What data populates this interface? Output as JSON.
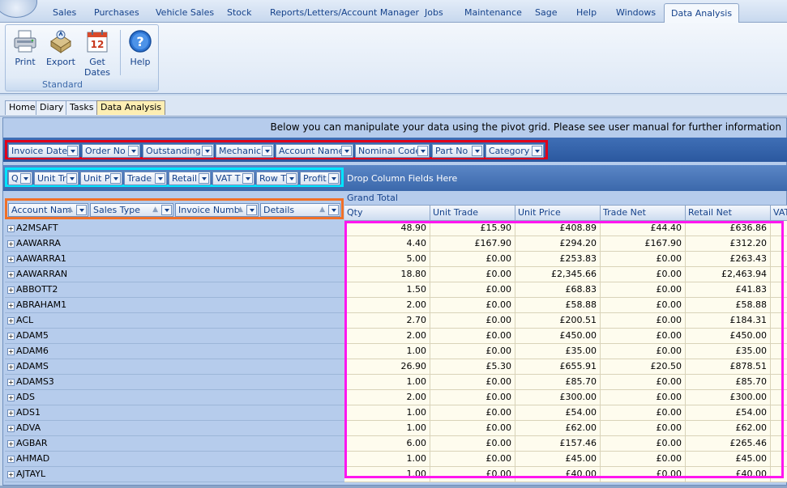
{
  "menu": [
    "Sales",
    "Purchases",
    "Vehicle Sales",
    "Stock",
    "Reports/Letters/Account Manager",
    "Jobs",
    "Maintenance",
    "Sage",
    "Help",
    "Windows",
    "Data Analysis"
  ],
  "ribbon": {
    "print": "Print",
    "export": "Export",
    "get_dates": "Get Dates",
    "help": "Help",
    "group_label": "Standard"
  },
  "tabs": [
    "Home",
    "Diary",
    "Tasks",
    "Data Analysis"
  ],
  "pivot": {
    "info": "Below you can manipulate your data using the pivot grid.  Please see user manual for further information",
    "filter_fields": [
      "Invoice Date",
      "Order No",
      "Outstanding",
      "Mechanic",
      "Account Name",
      "Nominal Code",
      "Part No",
      "Category"
    ],
    "data_fields": [
      "Q",
      "Unit Tr",
      "Unit P",
      "Trade",
      "Retail",
      "VAT T",
      "Row T",
      "Profit"
    ],
    "drop_column": "Drop Column Fields Here",
    "grand_total": "Grand Total",
    "row_fields": [
      "Account Nam",
      "Sales Type",
      "Invoice Numb",
      "Details"
    ],
    "columns": [
      "Qty",
      "Unit Trade",
      "Unit Price",
      "Trade Net",
      "Retail Net",
      "VAT"
    ],
    "rows": [
      {
        "name": "A2MSAFT",
        "qty": "48.90",
        "unit_trade": "£15.90",
        "unit_price": "£408.89",
        "trade_net": "£44.40",
        "retail_net": "£636.86"
      },
      {
        "name": "AAWARRA",
        "qty": "4.40",
        "unit_trade": "£167.90",
        "unit_price": "£294.20",
        "trade_net": "£167.90",
        "retail_net": "£312.20"
      },
      {
        "name": "AAWARRA1",
        "qty": "5.00",
        "unit_trade": "£0.00",
        "unit_price": "£253.83",
        "trade_net": "£0.00",
        "retail_net": "£263.43"
      },
      {
        "name": "AAWARRAN",
        "qty": "18.80",
        "unit_trade": "£0.00",
        "unit_price": "£2,345.66",
        "trade_net": "£0.00",
        "retail_net": "£2,463.94"
      },
      {
        "name": "ABBOTT2",
        "qty": "1.50",
        "unit_trade": "£0.00",
        "unit_price": "£68.83",
        "trade_net": "£0.00",
        "retail_net": "£41.83"
      },
      {
        "name": "ABRAHAM1",
        "qty": "2.00",
        "unit_trade": "£0.00",
        "unit_price": "£58.88",
        "trade_net": "£0.00",
        "retail_net": "£58.88"
      },
      {
        "name": "ACL",
        "qty": "2.70",
        "unit_trade": "£0.00",
        "unit_price": "£200.51",
        "trade_net": "£0.00",
        "retail_net": "£184.31"
      },
      {
        "name": "ADAM5",
        "qty": "2.00",
        "unit_trade": "£0.00",
        "unit_price": "£450.00",
        "trade_net": "£0.00",
        "retail_net": "£450.00"
      },
      {
        "name": "ADAM6",
        "qty": "1.00",
        "unit_trade": "£0.00",
        "unit_price": "£35.00",
        "trade_net": "£0.00",
        "retail_net": "£35.00"
      },
      {
        "name": "ADAMS",
        "qty": "26.90",
        "unit_trade": "£5.30",
        "unit_price": "£655.91",
        "trade_net": "£20.50",
        "retail_net": "£878.51"
      },
      {
        "name": "ADAMS3",
        "qty": "1.00",
        "unit_trade": "£0.00",
        "unit_price": "£85.70",
        "trade_net": "£0.00",
        "retail_net": "£85.70"
      },
      {
        "name": "ADS",
        "qty": "2.00",
        "unit_trade": "£0.00",
        "unit_price": "£300.00",
        "trade_net": "£0.00",
        "retail_net": "£300.00"
      },
      {
        "name": "ADS1",
        "qty": "1.00",
        "unit_trade": "£0.00",
        "unit_price": "£54.00",
        "trade_net": "£0.00",
        "retail_net": "£54.00"
      },
      {
        "name": "ADVA",
        "qty": "1.00",
        "unit_trade": "£0.00",
        "unit_price": "£62.00",
        "trade_net": "£0.00",
        "retail_net": "£62.00"
      },
      {
        "name": "AGBAR",
        "qty": "6.00",
        "unit_trade": "£0.00",
        "unit_price": "£157.46",
        "trade_net": "£0.00",
        "retail_net": "£265.46"
      },
      {
        "name": "AHMAD",
        "qty": "1.00",
        "unit_trade": "£0.00",
        "unit_price": "£45.00",
        "trade_net": "£0.00",
        "retail_net": "£45.00"
      },
      {
        "name": "AJTAYL",
        "qty": "1.00",
        "unit_trade": "£0.00",
        "unit_price": "£40.00",
        "trade_net": "£0.00",
        "retail_net": "£40.00"
      }
    ]
  }
}
